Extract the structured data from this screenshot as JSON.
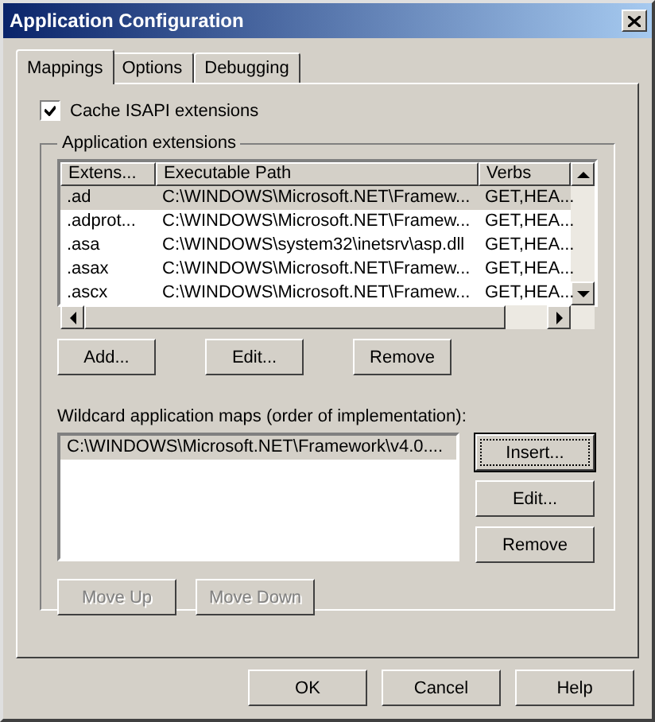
{
  "window": {
    "title": "Application Configuration"
  },
  "tabs": [
    {
      "label": "Mappings",
      "selected": true
    },
    {
      "label": "Options",
      "selected": false
    },
    {
      "label": "Debugging",
      "selected": false
    }
  ],
  "cache_isapi": {
    "label": "Cache ISAPI extensions",
    "checked": true
  },
  "extensions": {
    "title": "Application extensions",
    "columns": [
      "Extens...",
      "Executable Path",
      "Verbs"
    ],
    "rows": [
      {
        "cells": [
          ".ad",
          "C:\\WINDOWS\\Microsoft.NET\\Framew...",
          "GET,HEA..."
        ],
        "selected": true
      },
      {
        "cells": [
          ".adprot...",
          "C:\\WINDOWS\\Microsoft.NET\\Framew...",
          "GET,HEA..."
        ],
        "selected": false
      },
      {
        "cells": [
          ".asa",
          "C:\\WINDOWS\\system32\\inetsrv\\asp.dll",
          "GET,HEA..."
        ],
        "selected": false
      },
      {
        "cells": [
          ".asax",
          "C:\\WINDOWS\\Microsoft.NET\\Framew...",
          "GET,HEA..."
        ],
        "selected": false
      },
      {
        "cells": [
          ".ascx",
          "C:\\WINDOWS\\Microsoft.NET\\Framew...",
          "GET,HEA..."
        ],
        "selected": false
      }
    ],
    "buttons": [
      {
        "label": "Add...",
        "disabled": false
      },
      {
        "label": "Edit...",
        "disabled": false
      },
      {
        "label": "Remove",
        "disabled": false
      }
    ]
  },
  "wildcard": {
    "label": "Wildcard application maps (order of implementation):",
    "items": [
      {
        "text": "C:\\WINDOWS\\Microsoft.NET\\Framework\\v4.0....",
        "selected": true
      }
    ],
    "buttons": [
      {
        "label": "Insert...",
        "default": true
      },
      {
        "label": "Edit...",
        "default": false
      },
      {
        "label": "Remove",
        "default": false
      }
    ]
  },
  "move_buttons": [
    {
      "label": "Move Up",
      "disabled": true
    },
    {
      "label": "Move Down",
      "disabled": true
    }
  ],
  "dialog_buttons": [
    "OK",
    "Cancel",
    "Help"
  ]
}
